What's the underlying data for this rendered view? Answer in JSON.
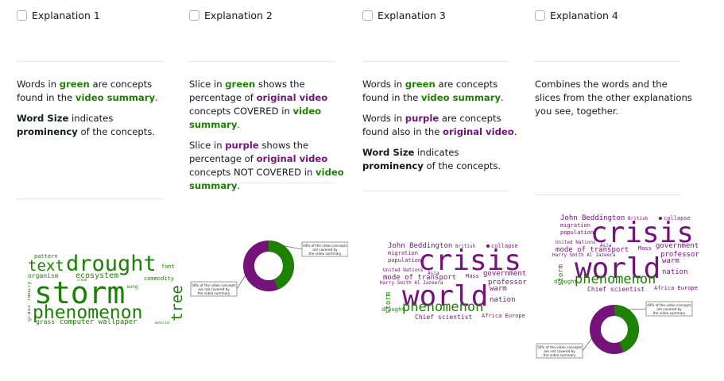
{
  "explanations": [
    {
      "title": "Explanation 1",
      "paragraphs": [
        [
          {
            "t": "Words in "
          },
          {
            "t": "green",
            "c": "g"
          },
          {
            "t": " are concepts found in the "
          },
          {
            "t": "video summary",
            "c": "g"
          },
          {
            "t": "."
          }
        ],
        [
          {
            "t": "Word Size",
            "c": "b"
          },
          {
            "t": " indicates "
          },
          {
            "t": "prominency",
            "c": "b"
          },
          {
            "t": " of the concepts."
          }
        ]
      ]
    },
    {
      "title": "Explanation 2",
      "paragraphs": [
        [
          {
            "t": "Slice in "
          },
          {
            "t": "green",
            "c": "g"
          },
          {
            "t": " shows the percentage of "
          },
          {
            "t": "original video",
            "c": "p"
          },
          {
            "t": " concepts COVERED in "
          },
          {
            "t": "video summary",
            "c": "g"
          },
          {
            "t": "."
          }
        ],
        [
          {
            "t": "Slice in "
          },
          {
            "t": "purple",
            "c": "p"
          },
          {
            "t": " shows the percentage of "
          },
          {
            "t": "original video",
            "c": "p"
          },
          {
            "t": " concepts NOT COVERED in "
          },
          {
            "t": "video summary",
            "c": "g"
          },
          {
            "t": "."
          }
        ]
      ]
    },
    {
      "title": "Explanation 3",
      "paragraphs": [
        [
          {
            "t": "Words in "
          },
          {
            "t": "green",
            "c": "g"
          },
          {
            "t": " are concepts found in the "
          },
          {
            "t": "video summary",
            "c": "g"
          },
          {
            "t": "."
          }
        ],
        [
          {
            "t": "Words in "
          },
          {
            "t": "purple",
            "c": "p"
          },
          {
            "t": " are concepts found also in the "
          },
          {
            "t": "original video",
            "c": "p"
          },
          {
            "t": "."
          }
        ],
        [
          {
            "t": "Word Size",
            "c": "b"
          },
          {
            "t": " indicates "
          },
          {
            "t": "prominency",
            "c": "b"
          },
          {
            "t": " of the concepts."
          }
        ]
      ]
    },
    {
      "title": "Explanation 4",
      "paragraphs": [
        [
          {
            "t": "Combines the words and the slices from the other explanations you see, together."
          }
        ]
      ]
    }
  ],
  "donut": {
    "covered_pct": 44,
    "not_covered_pct": 56,
    "covered_label": [
      "44% of the video concepts",
      "are covered by",
      "the video summary"
    ],
    "not_covered_label": [
      "56% of the video concepts",
      "are not covered by",
      "the video summary"
    ]
  },
  "colors": {
    "green": "#1d8102",
    "purple": "#75137a",
    "rule": "#e4e7eb"
  },
  "cloud1_words": [
    "pattern",
    "text",
    "drought",
    "font",
    "organism",
    "ecosystem",
    "commodity",
    "storm",
    "grass family",
    "crowd",
    "song",
    "phenomenon",
    "tree",
    "grass",
    "computer wallpaper",
    "material"
  ],
  "cloud3_words": [
    "John Beddington",
    "British",
    "collapse",
    "migration",
    "crisis",
    "population",
    "United Nations",
    "mode of transport",
    "Mass",
    "government",
    "Harry Smith Al Jazeera",
    "Asia",
    "professor",
    "world",
    "storm",
    "warm",
    "nation",
    "phenomenon",
    "drought",
    "Chief scientist",
    "Africa Europe"
  ]
}
